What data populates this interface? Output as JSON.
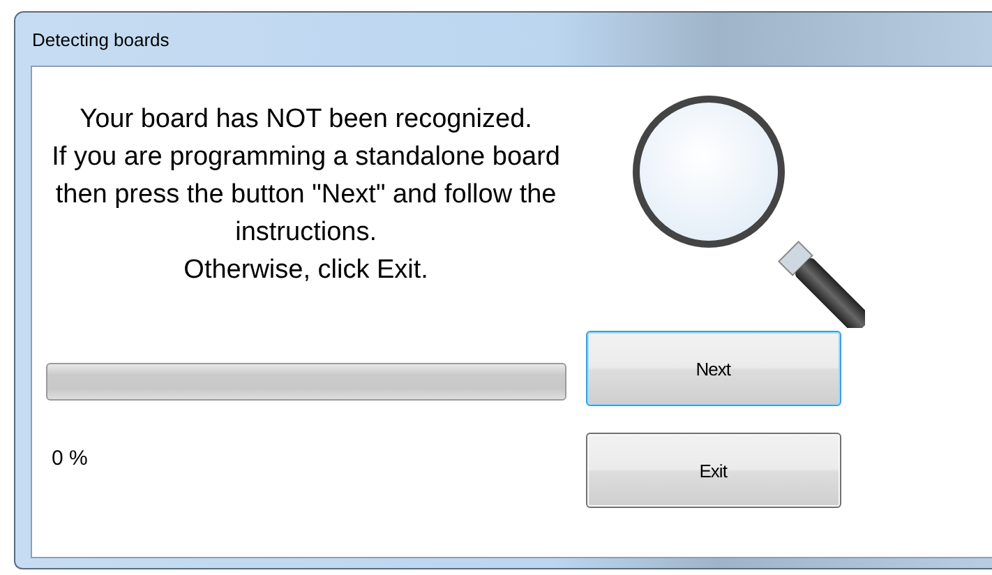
{
  "window": {
    "title": "Detecting boards"
  },
  "message": [
    "Your board has NOT been recognized.",
    "If you are programming a standalone board",
    "then press the button \"Next\" and follow the",
    "instructions.",
    "Otherwise, click Exit."
  ],
  "progress": {
    "level": 0,
    "reading": "0 %"
  },
  "buttons": [
    {
      "label": "Next",
      "focused": true
    },
    {
      "label": "Exit",
      "focused": false
    }
  ]
}
